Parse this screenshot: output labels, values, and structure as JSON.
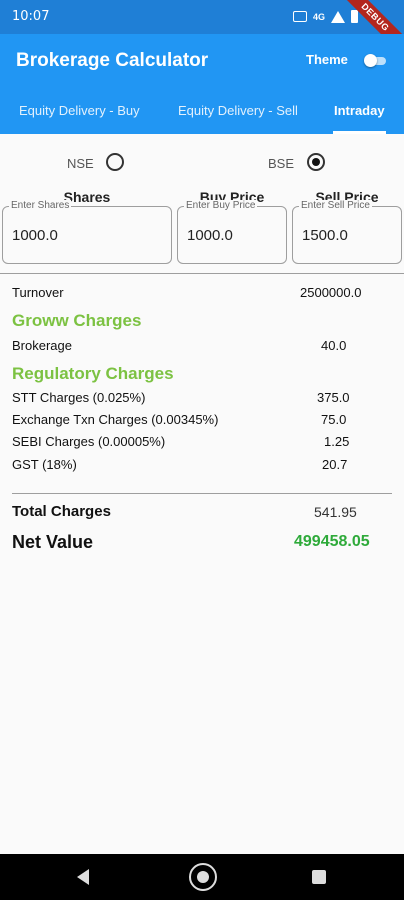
{
  "status_bar": {
    "time": "10:07",
    "signal_text": "4G"
  },
  "debug_banner": "DEBUG",
  "app_bar": {
    "title": "Brokerage Calculator",
    "theme_label": "Theme",
    "theme_toggle_on": false,
    "tabs": [
      {
        "label": "Equity Delivery - Buy",
        "active": false
      },
      {
        "label": "Equity Delivery - Sell",
        "active": false
      },
      {
        "label": "Intraday",
        "active": true
      }
    ]
  },
  "exchange": {
    "options": [
      {
        "label": "NSE",
        "selected": false
      },
      {
        "label": "BSE",
        "selected": true
      }
    ]
  },
  "inputs": [
    {
      "header": "Shares",
      "placeholder": "Enter Shares",
      "value": "1000.0"
    },
    {
      "header": "Buy Price",
      "placeholder": "Enter Buy Price",
      "value": "1000.0"
    },
    {
      "header": "Sell Price",
      "placeholder": "Enter Sell Price",
      "value": "1500.0"
    }
  ],
  "turnover": {
    "label": "Turnover",
    "value": "2500000.0"
  },
  "groww": {
    "title": "Groww Charges",
    "rows": [
      {
        "label": "Brokerage",
        "value": "40.0"
      }
    ]
  },
  "regulatory": {
    "title": "Regulatory Charges",
    "rows": [
      {
        "label": "STT Charges (0.025%)",
        "value": "375.0"
      },
      {
        "label": "Exchange Txn Charges (0.00345%)",
        "value": "75.0"
      },
      {
        "label": "SEBI Charges (0.00005%)",
        "value": "1.25"
      },
      {
        "label": "GST (18%)",
        "value": "20.7"
      }
    ]
  },
  "totals": {
    "total_label": "Total Charges",
    "total_value": "541.95",
    "net_label": "Net Value",
    "net_value": "499458.05"
  },
  "colors": {
    "app_bar": "#2196f3",
    "status_bar": "#1f7fd6",
    "section_title": "#7cc242",
    "net_value": "#2eaa3a",
    "debug_banner": "#b3261e"
  }
}
